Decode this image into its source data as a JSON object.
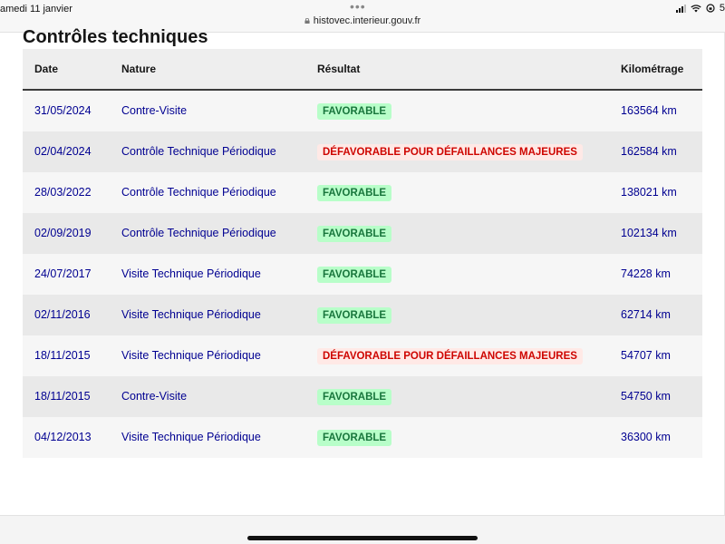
{
  "status_bar": {
    "date": "amedi 11 janvier",
    "dots": "•••",
    "url": "histovec.interieur.gouv.fr",
    "battery_text": "5"
  },
  "section": {
    "title": "Contrôles techniques"
  },
  "table": {
    "headers": {
      "date": "Date",
      "nature": "Nature",
      "result": "Résultat",
      "mileage": "Kilométrage"
    },
    "rows": [
      {
        "date": "31/05/2024",
        "nature": "Contre-Visite",
        "result": "FAVORABLE",
        "result_status": "favorable",
        "mileage": "163564 km"
      },
      {
        "date": "02/04/2024",
        "nature": "Contrôle Technique Périodique",
        "result": "DÉFAVORABLE POUR DÉFAILLANCES MAJEURES",
        "result_status": "defavorable",
        "mileage": "162584 km"
      },
      {
        "date": "28/03/2022",
        "nature": "Contrôle Technique Périodique",
        "result": "FAVORABLE",
        "result_status": "favorable",
        "mileage": "138021 km"
      },
      {
        "date": "02/09/2019",
        "nature": "Contrôle Technique Périodique",
        "result": "FAVORABLE",
        "result_status": "favorable",
        "mileage": "102134 km"
      },
      {
        "date": "24/07/2017",
        "nature": "Visite Technique Périodique",
        "result": "FAVORABLE",
        "result_status": "favorable",
        "mileage": "74228 km"
      },
      {
        "date": "02/11/2016",
        "nature": "Visite Technique Périodique",
        "result": "FAVORABLE",
        "result_status": "favorable",
        "mileage": "62714 km"
      },
      {
        "date": "18/11/2015",
        "nature": "Visite Technique Périodique",
        "result": "DÉFAVORABLE POUR DÉFAILLANCES MAJEURES",
        "result_status": "defavorable",
        "mileage": "54707 km"
      },
      {
        "date": "18/11/2015",
        "nature": "Contre-Visite",
        "result": "FAVORABLE",
        "result_status": "favorable",
        "mileage": "54750 km"
      },
      {
        "date": "04/12/2013",
        "nature": "Visite Technique Périodique",
        "result": "FAVORABLE",
        "result_status": "favorable",
        "mileage": "36300 km"
      }
    ]
  },
  "colors": {
    "link_blue": "#000091",
    "favorable_bg": "#b8fec9",
    "favorable_text": "#18753c",
    "defavorable_bg": "#ffe9e6",
    "defavorable_text": "#ce0500"
  },
  "icons": [
    "lock-icon",
    "signal-icon",
    "wifi-icon",
    "orientation-lock-icon"
  ]
}
